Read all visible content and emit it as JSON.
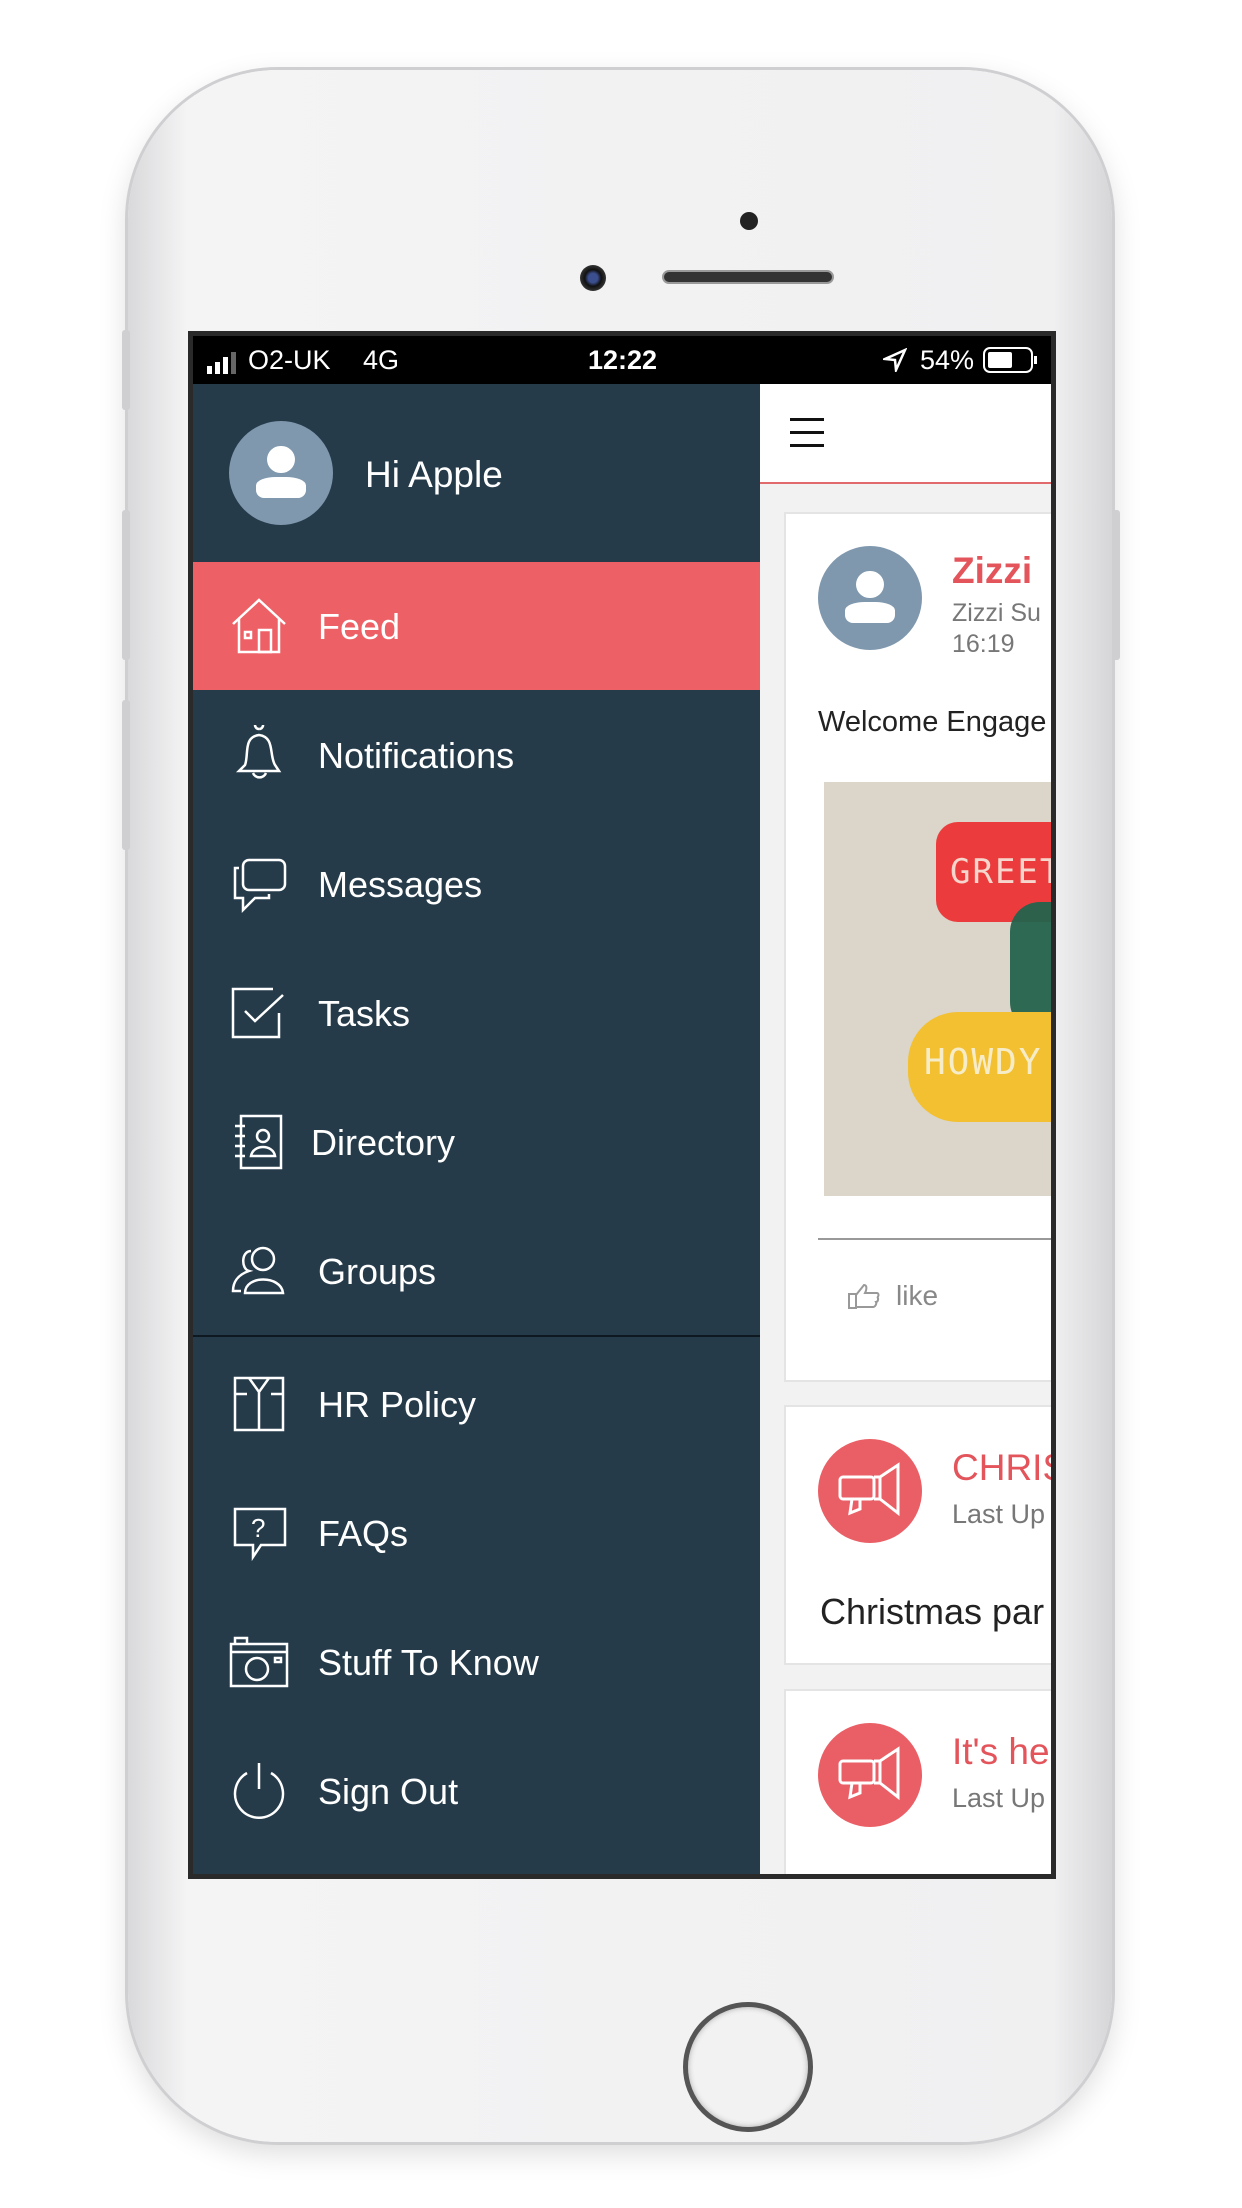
{
  "status_bar": {
    "carrier": "O2-UK",
    "network": "4G",
    "time": "12:22",
    "battery": "54%",
    "battery_level": 0.54
  },
  "drawer": {
    "greeting": "Hi Apple",
    "items": [
      {
        "label": "Feed",
        "icon": "home-icon",
        "active": true
      },
      {
        "label": "Notifications",
        "icon": "bell-icon"
      },
      {
        "label": "Messages",
        "icon": "chat-icon"
      },
      {
        "label": "Tasks",
        "icon": "checkbox-icon"
      },
      {
        "label": "Directory",
        "icon": "contacts-book-icon"
      },
      {
        "label": "Groups",
        "icon": "group-icon"
      }
    ],
    "secondary_items": [
      {
        "label": "HR Policy",
        "icon": "shirt-icon"
      },
      {
        "label": "FAQs",
        "icon": "question-bubble-icon"
      },
      {
        "label": "Stuff To Know",
        "icon": "camera-icon"
      },
      {
        "label": "Sign Out",
        "icon": "power-icon"
      }
    ]
  },
  "feed": {
    "posts": [
      {
        "author": "Zizzi",
        "subtitle": "Zizzi Su",
        "time": "16:19",
        "text": "Welcome Engage",
        "image_words": [
          "GREETI",
          "HOWDY"
        ],
        "like_label": "like"
      },
      {
        "title": "CHRIS",
        "subtitle": "Last Up",
        "text": "Christmas par"
      },
      {
        "title": "It's he",
        "subtitle": "Last Up"
      }
    ]
  },
  "colors": {
    "drawer_bg": "#253b4a",
    "accent": "#ed6166",
    "avatar": "#7f98ae"
  }
}
